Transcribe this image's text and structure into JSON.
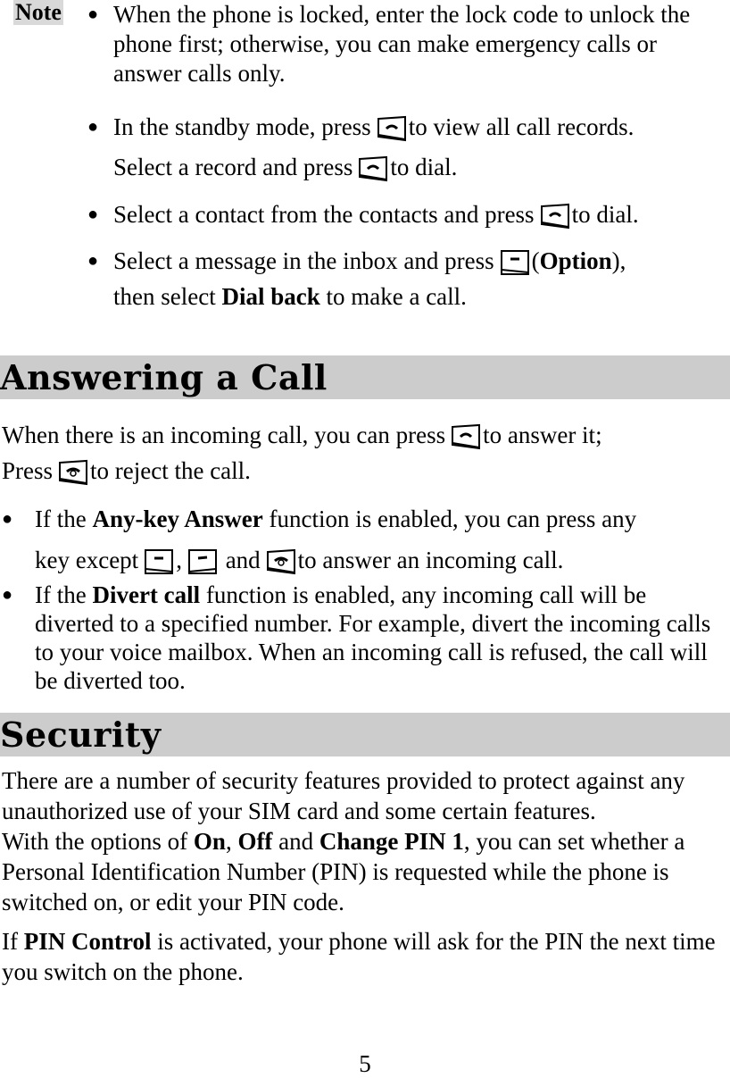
{
  "note": {
    "label": "Note",
    "items": [
      {
        "lines": [
          {
            "t": "When the phone is locked, enter the lock code to unlock the phone first; otherwise, you can make emergency calls or answer calls only."
          }
        ]
      },
      {
        "parts": [
          "In the standby mode, press",
          "to view all call records.",
          "Select a record and press",
          "to dial."
        ],
        "icon": "send-key-icon"
      },
      {
        "parts": [
          "Select a contact from the contacts and press",
          "to dial."
        ],
        "icon": "send-key-icon"
      },
      {
        "parts": [
          "Select a message in the inbox and press",
          "(",
          "Option",
          "),",
          "then select",
          "Dial back",
          "to make a call."
        ],
        "icon": "left-soft-key-icon"
      }
    ]
  },
  "answering": {
    "heading": "Answering a Call",
    "intro": [
      "When there is an incoming call, you can press",
      "to answer it;",
      "Press",
      "to reject the call."
    ],
    "bullets": [
      {
        "pre": "If the",
        "bold": "Any-key Answer",
        "post": "function is enabled, you can press any",
        "line2_pre": "key except",
        "sep1": ",",
        "sep2": "and",
        "line2_post": "to answer an incoming call."
      },
      {
        "pre": "If the",
        "bold": "Divert call",
        "post": "function is enabled, any incoming call will be diverted to a specified number. For example, divert the incoming calls to your voice mailbox. When an incoming call is refused, the call will be diverted too."
      }
    ]
  },
  "security": {
    "heading": "Security",
    "para1": "There are a number of security features provided to protect against any unauthorized use of your SIM card and some certain features.",
    "para2": {
      "pre": "With the options of",
      "on": "On",
      "comma": ",",
      "off": "Off",
      "and": "and",
      "change": "Change PIN 1",
      "post": ", you can set whether a Personal Identification Number (PIN) is requested while the phone is switched on, or edit your PIN code."
    },
    "para3": {
      "pre": "If",
      "bold": "PIN Control",
      "post": "is activated, your phone will ask for the PIN the next time you switch on the phone."
    }
  },
  "footer": {
    "page_number": "5"
  },
  "colors": {
    "heading_bg": "#cccccc",
    "note_bg": "#d9d9d9"
  }
}
